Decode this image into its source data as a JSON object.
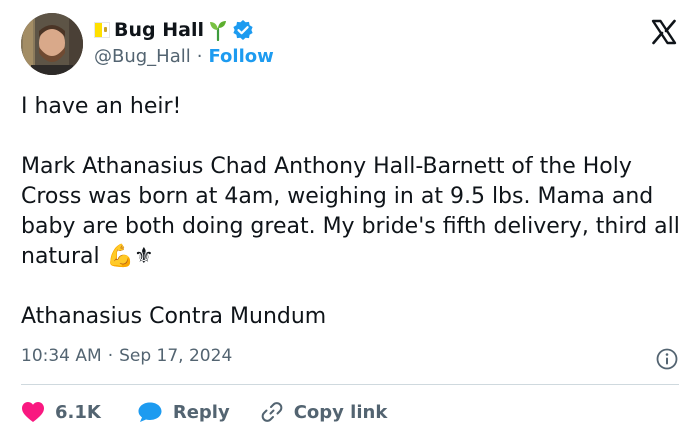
{
  "author": {
    "name": "Bug Hall",
    "handle": "@Bug_Hall",
    "separator": "·",
    "follow_label": "Follow"
  },
  "tweet": {
    "line1": "I have an heir!",
    "paragraph": "Mark Athanasius Chad Anthony Hall-Barnett of the Holy Cross was born at 4am, weighing in at 9.5 lbs. Mama and baby are both doing great. My bride's fifth delivery, third all natural",
    "emoji": "💪⚜",
    "closing": "Athanasius Contra Mundum"
  },
  "meta": {
    "time": "10:34 AM",
    "separator": "·",
    "date": "Sep 17, 2024"
  },
  "actions": {
    "likes": "6.1K",
    "reply": "Reply",
    "copy_link": "Copy link"
  },
  "colors": {
    "heart": "#f91880",
    "reply_bubble": "#1d9bf0",
    "verified": "#1d9bf0",
    "follow": "#1d9bf0"
  }
}
